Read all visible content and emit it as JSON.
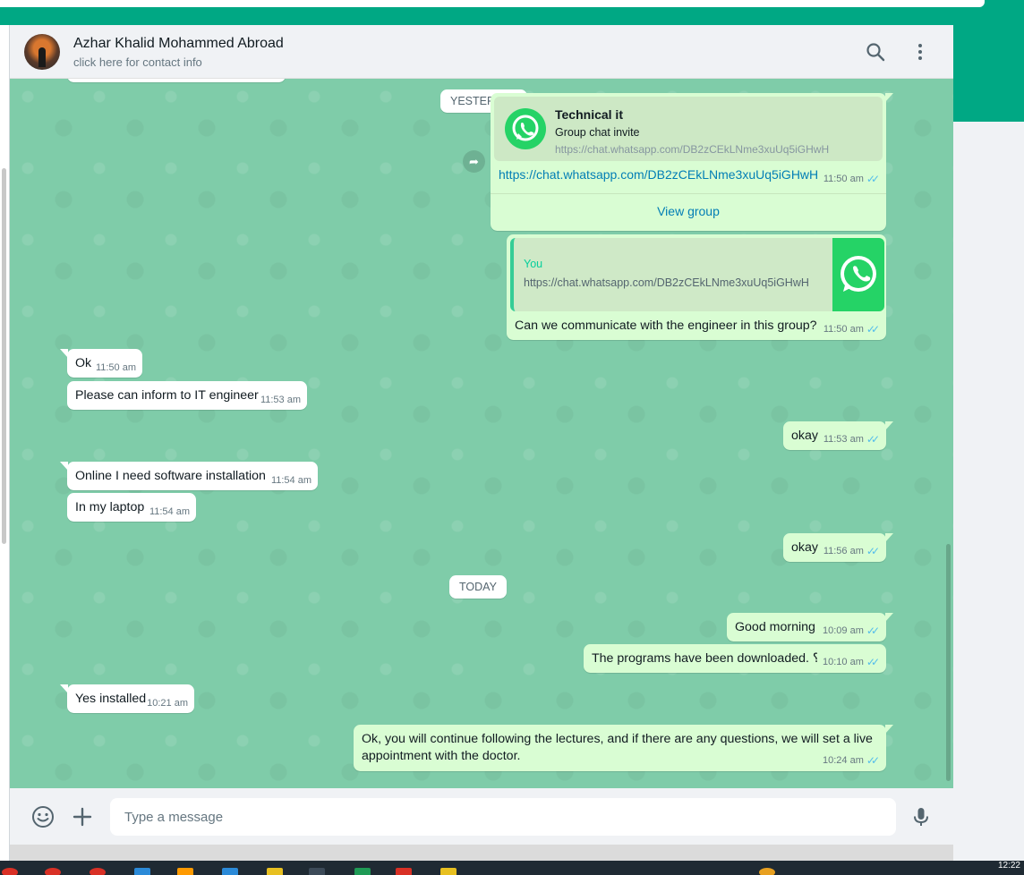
{
  "header": {
    "contact_name": "Azhar Khalid Mohammed Abroad",
    "contact_sub": "click here for contact info",
    "icons": [
      "search-icon",
      "menu-icon"
    ]
  },
  "dates": {
    "yesterday": "YESTERDAY",
    "today": "TODAY"
  },
  "invite": {
    "group_name": "Technical it",
    "subtitle": "Group chat invite",
    "link_preview": "https://chat.whatsapp.com/DB2zCEkLNme3xuUq5iGHwH",
    "link": "https://chat.whatsapp.com/DB2zCEkLNme3xuUq5iGHwH",
    "time": "11:50 am",
    "button": "View group"
  },
  "reply": {
    "quoted_author": "You",
    "quoted_text": "https://chat.whatsapp.com/DB2zCEkLNme3xuUq5iGHwH",
    "text": "Can we communicate with the engineer in this group?",
    "time": "11:50 am"
  },
  "messages": [
    {
      "dir": "in",
      "text": "Ok",
      "time": "11:50 am"
    },
    {
      "dir": "in",
      "text": "Please can inform to IT engineer",
      "time": "11:53 am"
    },
    {
      "dir": "out",
      "text": "okay",
      "time": "11:53 am"
    },
    {
      "dir": "in",
      "text": "Online I need software installation",
      "time": "11:54 am"
    },
    {
      "dir": "in",
      "text": "In my laptop",
      "time": "11:54 am"
    },
    {
      "dir": "out",
      "text": "okay",
      "time": "11:56 am"
    },
    {
      "dir": "out",
      "text": "Good morning",
      "time": "10:09 am"
    },
    {
      "dir": "out",
      "text": "The programs have been downloaded. ؟",
      "time": "10:10 am"
    },
    {
      "dir": "in",
      "text": "Yes installed",
      "time": "10:21 am"
    },
    {
      "dir": "out",
      "text": "Ok, you will continue following the lectures, and if there are any questions, we will set a live",
      "text2": "appointment with the doctor.",
      "time": "10:24 am"
    }
  ],
  "composer": {
    "placeholder": "Type a message",
    "icons": [
      "emoji-icon",
      "attach-plus-icon",
      "microphone-icon"
    ]
  },
  "colors": {
    "accent": "#00a884",
    "outgoing_bubble": "#d9fdd3",
    "incoming_bubble": "#ffffff",
    "read_tick": "#53bdeb",
    "wallpaper": "#7fcca9"
  },
  "taskbar": {
    "clock": "12:22"
  }
}
